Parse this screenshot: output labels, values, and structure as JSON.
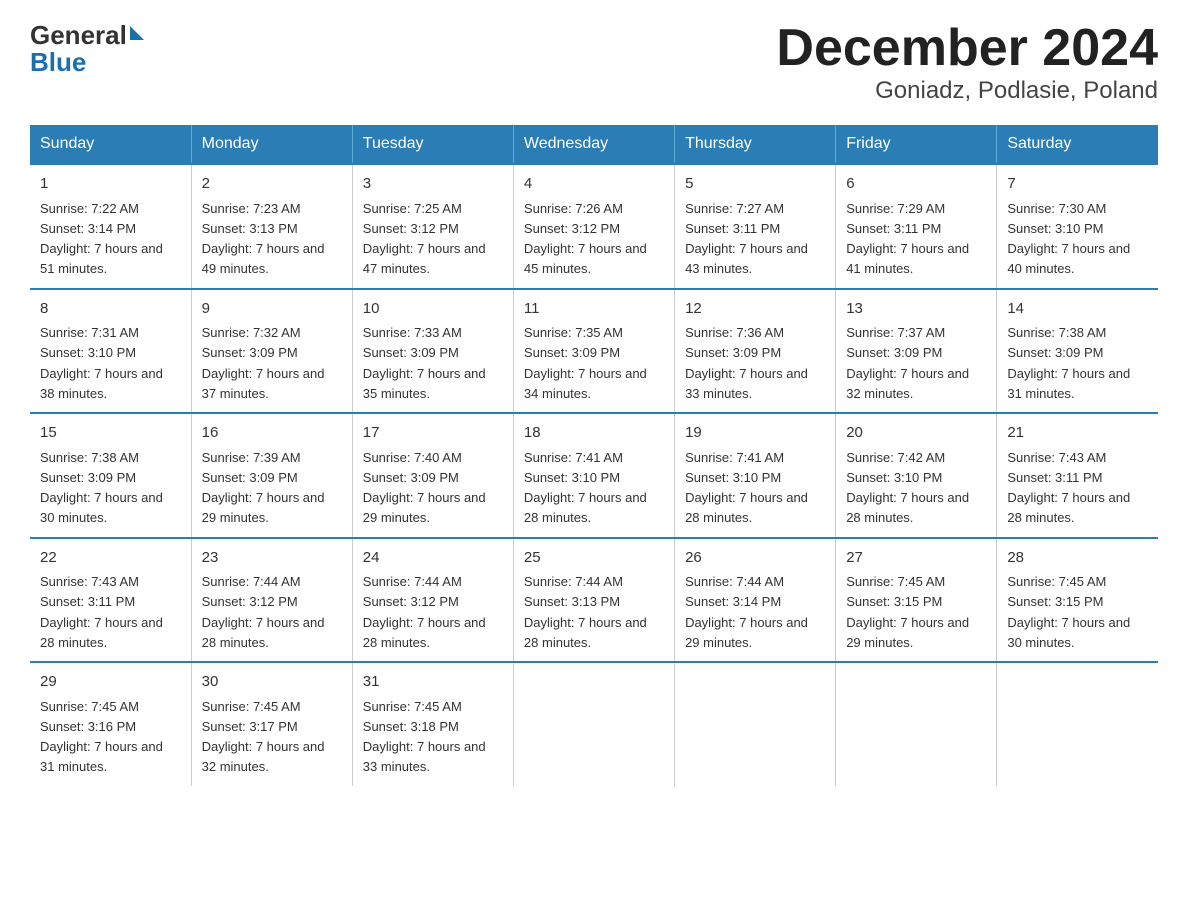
{
  "logo": {
    "text_general": "General",
    "text_blue": "Blue"
  },
  "title": {
    "month_year": "December 2024",
    "location": "Goniadz, Podlasie, Poland"
  },
  "days_of_week": [
    "Sunday",
    "Monday",
    "Tuesday",
    "Wednesday",
    "Thursday",
    "Friday",
    "Saturday"
  ],
  "weeks": [
    [
      {
        "day": "1",
        "sunrise": "7:22 AM",
        "sunset": "3:14 PM",
        "daylight": "7 hours and 51 minutes."
      },
      {
        "day": "2",
        "sunrise": "7:23 AM",
        "sunset": "3:13 PM",
        "daylight": "7 hours and 49 minutes."
      },
      {
        "day": "3",
        "sunrise": "7:25 AM",
        "sunset": "3:12 PM",
        "daylight": "7 hours and 47 minutes."
      },
      {
        "day": "4",
        "sunrise": "7:26 AM",
        "sunset": "3:12 PM",
        "daylight": "7 hours and 45 minutes."
      },
      {
        "day": "5",
        "sunrise": "7:27 AM",
        "sunset": "3:11 PM",
        "daylight": "7 hours and 43 minutes."
      },
      {
        "day": "6",
        "sunrise": "7:29 AM",
        "sunset": "3:11 PM",
        "daylight": "7 hours and 41 minutes."
      },
      {
        "day": "7",
        "sunrise": "7:30 AM",
        "sunset": "3:10 PM",
        "daylight": "7 hours and 40 minutes."
      }
    ],
    [
      {
        "day": "8",
        "sunrise": "7:31 AM",
        "sunset": "3:10 PM",
        "daylight": "7 hours and 38 minutes."
      },
      {
        "day": "9",
        "sunrise": "7:32 AM",
        "sunset": "3:09 PM",
        "daylight": "7 hours and 37 minutes."
      },
      {
        "day": "10",
        "sunrise": "7:33 AM",
        "sunset": "3:09 PM",
        "daylight": "7 hours and 35 minutes."
      },
      {
        "day": "11",
        "sunrise": "7:35 AM",
        "sunset": "3:09 PM",
        "daylight": "7 hours and 34 minutes."
      },
      {
        "day": "12",
        "sunrise": "7:36 AM",
        "sunset": "3:09 PM",
        "daylight": "7 hours and 33 minutes."
      },
      {
        "day": "13",
        "sunrise": "7:37 AM",
        "sunset": "3:09 PM",
        "daylight": "7 hours and 32 minutes."
      },
      {
        "day": "14",
        "sunrise": "7:38 AM",
        "sunset": "3:09 PM",
        "daylight": "7 hours and 31 minutes."
      }
    ],
    [
      {
        "day": "15",
        "sunrise": "7:38 AM",
        "sunset": "3:09 PM",
        "daylight": "7 hours and 30 minutes."
      },
      {
        "day": "16",
        "sunrise": "7:39 AM",
        "sunset": "3:09 PM",
        "daylight": "7 hours and 29 minutes."
      },
      {
        "day": "17",
        "sunrise": "7:40 AM",
        "sunset": "3:09 PM",
        "daylight": "7 hours and 29 minutes."
      },
      {
        "day": "18",
        "sunrise": "7:41 AM",
        "sunset": "3:10 PM",
        "daylight": "7 hours and 28 minutes."
      },
      {
        "day": "19",
        "sunrise": "7:41 AM",
        "sunset": "3:10 PM",
        "daylight": "7 hours and 28 minutes."
      },
      {
        "day": "20",
        "sunrise": "7:42 AM",
        "sunset": "3:10 PM",
        "daylight": "7 hours and 28 minutes."
      },
      {
        "day": "21",
        "sunrise": "7:43 AM",
        "sunset": "3:11 PM",
        "daylight": "7 hours and 28 minutes."
      }
    ],
    [
      {
        "day": "22",
        "sunrise": "7:43 AM",
        "sunset": "3:11 PM",
        "daylight": "7 hours and 28 minutes."
      },
      {
        "day": "23",
        "sunrise": "7:44 AM",
        "sunset": "3:12 PM",
        "daylight": "7 hours and 28 minutes."
      },
      {
        "day": "24",
        "sunrise": "7:44 AM",
        "sunset": "3:12 PM",
        "daylight": "7 hours and 28 minutes."
      },
      {
        "day": "25",
        "sunrise": "7:44 AM",
        "sunset": "3:13 PM",
        "daylight": "7 hours and 28 minutes."
      },
      {
        "day": "26",
        "sunrise": "7:44 AM",
        "sunset": "3:14 PM",
        "daylight": "7 hours and 29 minutes."
      },
      {
        "day": "27",
        "sunrise": "7:45 AM",
        "sunset": "3:15 PM",
        "daylight": "7 hours and 29 minutes."
      },
      {
        "day": "28",
        "sunrise": "7:45 AM",
        "sunset": "3:15 PM",
        "daylight": "7 hours and 30 minutes."
      }
    ],
    [
      {
        "day": "29",
        "sunrise": "7:45 AM",
        "sunset": "3:16 PM",
        "daylight": "7 hours and 31 minutes."
      },
      {
        "day": "30",
        "sunrise": "7:45 AM",
        "sunset": "3:17 PM",
        "daylight": "7 hours and 32 minutes."
      },
      {
        "day": "31",
        "sunrise": "7:45 AM",
        "sunset": "3:18 PM",
        "daylight": "7 hours and 33 minutes."
      },
      null,
      null,
      null,
      null
    ]
  ]
}
